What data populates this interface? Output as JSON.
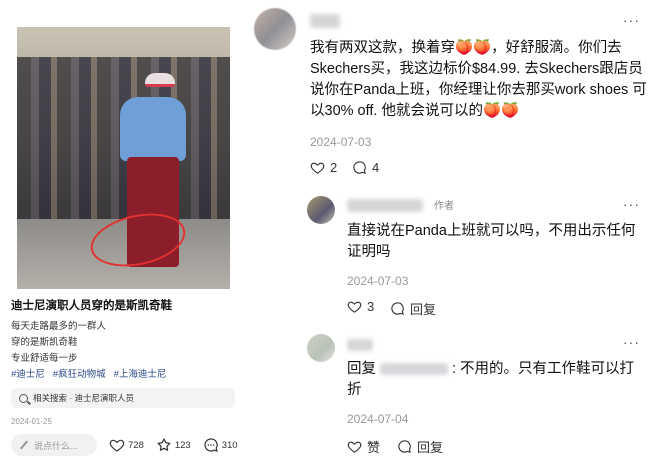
{
  "post": {
    "title": "迪士尼演职人员穿的是斯凯奇鞋",
    "desc_lines": [
      "每天走路最多的一群人",
      "穿的是斯凯奇鞋",
      "专业舒适每一步"
    ],
    "tags": [
      "#迪士尼",
      "#疯狂动物城",
      "#上海迪士尼"
    ],
    "related_search": "相关搜索 · 迪士尼演职人员",
    "date": "2024-01-25",
    "comment_placeholder": "说点什么...",
    "likes": "728",
    "favorites": "123",
    "comments": "310"
  },
  "comments": [
    {
      "text": "我有两双这款，换着穿🍑🍑，好舒服滴。你们去Skechers买，我这边标价$84.99. 去Skechers跟店员说你在Panda上班，你经理让你去那买work shoes 可以30% off. 他就会说可以的🍑🍑",
      "date": "2024-07-03",
      "likes": "2",
      "replies": "4"
    },
    {
      "author_tag": "作者",
      "text": "直接说在Panda上班就可以吗，不用出示任何证明吗",
      "date": "2024-07-03",
      "likes": "3",
      "reply_label": "回复"
    },
    {
      "reply_prefix": "回复",
      "text": ": 不用的。只有工作鞋可以打折",
      "date": "2024-07-04",
      "like_label": "赞",
      "reply_label": "回复"
    }
  ],
  "more_label": "···"
}
